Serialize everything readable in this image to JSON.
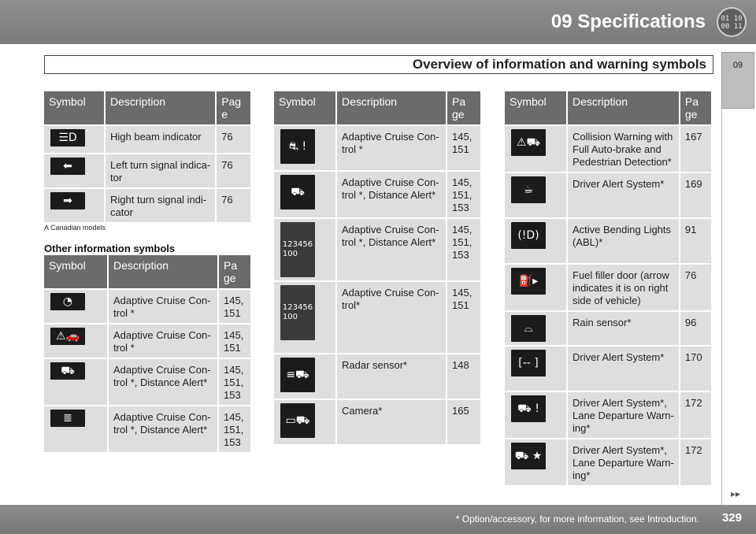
{
  "header": {
    "chapter_title": "09 Specifications",
    "badge": "01 10\n00 11",
    "side_tab": "09"
  },
  "section_title": "Overview of information and warning symbols",
  "table1": {
    "headers": [
      "Symbol",
      "Description",
      "Pag\ne"
    ],
    "rows": [
      {
        "icon": "high-beam-icon",
        "glyph": "☰D",
        "desc": "High beam indicator",
        "page": "76"
      },
      {
        "icon": "left-turn-icon",
        "glyph": "⬅",
        "desc": "Left turn signal indica-\ntor",
        "page": "76"
      },
      {
        "icon": "right-turn-icon",
        "glyph": "➡",
        "desc": "Right turn signal indi-\ncator",
        "page": "76"
      }
    ]
  },
  "footnote_a": "A Canadian models",
  "other_heading": "Other information symbols",
  "table2": {
    "headers": [
      "Symbol",
      "Description",
      "Pa\nge"
    ],
    "rows": [
      {
        "icon": "cruise-gauge-icon",
        "glyph": "◔",
        "desc": "Adaptive Cruise Con-\ntrol *",
        "page": "145,\n151"
      },
      {
        "icon": "cruise-car-icon",
        "glyph": "⚠🚗",
        "desc": "Adaptive Cruise Con-\ntrol *",
        "page": "145,\n151"
      },
      {
        "icon": "cruise-lane-icon",
        "glyph": "⛟",
        "desc": "Adaptive Cruise Con-\ntrol *, Distance Alert*",
        "page": "145,\n151,\n153"
      },
      {
        "icon": "cruise-distance-icon",
        "glyph": "≣",
        "desc": "Adaptive Cruise Con-\ntrol *, Distance Alert*",
        "page": "145,\n151,\n153"
      }
    ]
  },
  "table3": {
    "headers": [
      "Symbol",
      "Description",
      "Pa\nge"
    ],
    "rows": [
      {
        "icon": "cruise-warning-icon",
        "glyph": "⛐ !",
        "desc": "Adaptive Cruise Con-\ntrol *",
        "page": "145,\n151"
      },
      {
        "icon": "cruise-road-icon",
        "glyph": "⛟",
        "desc": "Adaptive Cruise Con-\ntrol *, Distance Alert*",
        "page": "145,\n151,\n153"
      },
      {
        "icon": "cruise-display-icon",
        "glyph": "123456\n100",
        "desc": "Adaptive Cruise Con-\ntrol *, Distance Alert*",
        "page": "145,\n151,\n153"
      },
      {
        "icon": "cruise-display2-icon",
        "glyph": "123456\n100",
        "desc": "Adaptive Cruise Con-\ntrol*",
        "page": "145,\n151"
      },
      {
        "icon": "radar-icon",
        "glyph": "≡⛟",
        "desc": "Radar sensor*",
        "page": "148"
      },
      {
        "icon": "camera-icon",
        "glyph": "▭⛟",
        "desc": "Camera*",
        "page": "165"
      }
    ]
  },
  "table4": {
    "headers": [
      "Symbol",
      "Description",
      "Pa\nge"
    ],
    "rows": [
      {
        "icon": "collision-warning-icon",
        "glyph": "⚠⛟",
        "desc": "Collision Warning with\nFull Auto-brake and\nPedestrian Detection*",
        "page": "167"
      },
      {
        "icon": "coffee-cup-icon",
        "glyph": "☕",
        "desc": "Driver Alert System*",
        "page": "169"
      },
      {
        "icon": "bending-lights-icon",
        "glyph": "(!D)",
        "desc": "Active Bending Lights\n(ABL)*",
        "page": "91"
      },
      {
        "icon": "fuel-filler-icon",
        "glyph": "⛽▸",
        "desc": "Fuel filler door (arrow\nindicates it is on right\nside of vehicle)",
        "page": "76"
      },
      {
        "icon": "rain-sensor-icon",
        "glyph": "⌓",
        "desc": "Rain sensor*",
        "page": "96"
      },
      {
        "icon": "driver-alert-bar-icon",
        "glyph": "[-- ]",
        "desc": "Driver Alert System*",
        "page": "170"
      },
      {
        "icon": "lane-departure-icon",
        "glyph": "⛟ !",
        "desc": "Driver Alert System*,\nLane Departure Warn-\ning*",
        "page": "172"
      },
      {
        "icon": "lane-departure-star-icon",
        "glyph": "⛟ ★",
        "desc": "Driver Alert System*,\nLane Departure Warn-\ning*",
        "page": "172"
      }
    ]
  },
  "footer": {
    "note": "* Option/accessory, for more information, see Introduction.",
    "page_number": "329",
    "next_marker": "▸▸"
  }
}
